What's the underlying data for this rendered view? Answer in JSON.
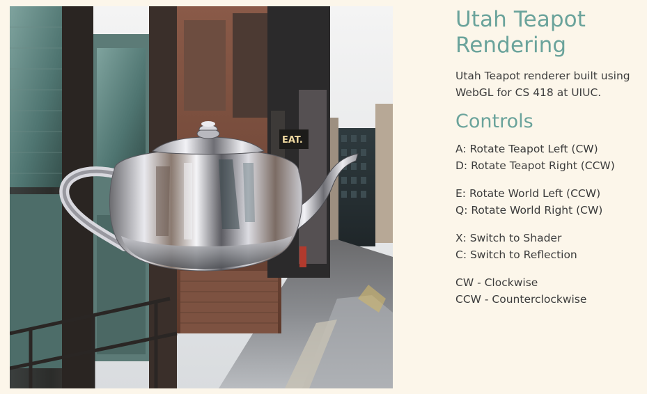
{
  "title": "Utah Teapot Rendering",
  "description": "Utah Teapot renderer built using WebGL for CS 418 at UIUC.",
  "controls": {
    "heading": "Controls",
    "groups": [
      {
        "lines": [
          "A: Rotate Teapot Left (CW)",
          "D: Rotate Teapot Right (CCW)"
        ]
      },
      {
        "lines": [
          "E: Rotate World Left (CCW)",
          "Q: Rotate World Right (CW)"
        ]
      },
      {
        "lines": [
          "X: Switch to Shader",
          "C: Switch to Reflection"
        ]
      },
      {
        "lines": [
          "CW - Clockwise",
          "CCW - Counterclockwise"
        ]
      }
    ]
  },
  "scene": {
    "shop_sign": "EAT.",
    "colors": {
      "background": "#fcf6ea",
      "accent": "#6aa39b",
      "body_text": "#3c3c3c"
    }
  }
}
